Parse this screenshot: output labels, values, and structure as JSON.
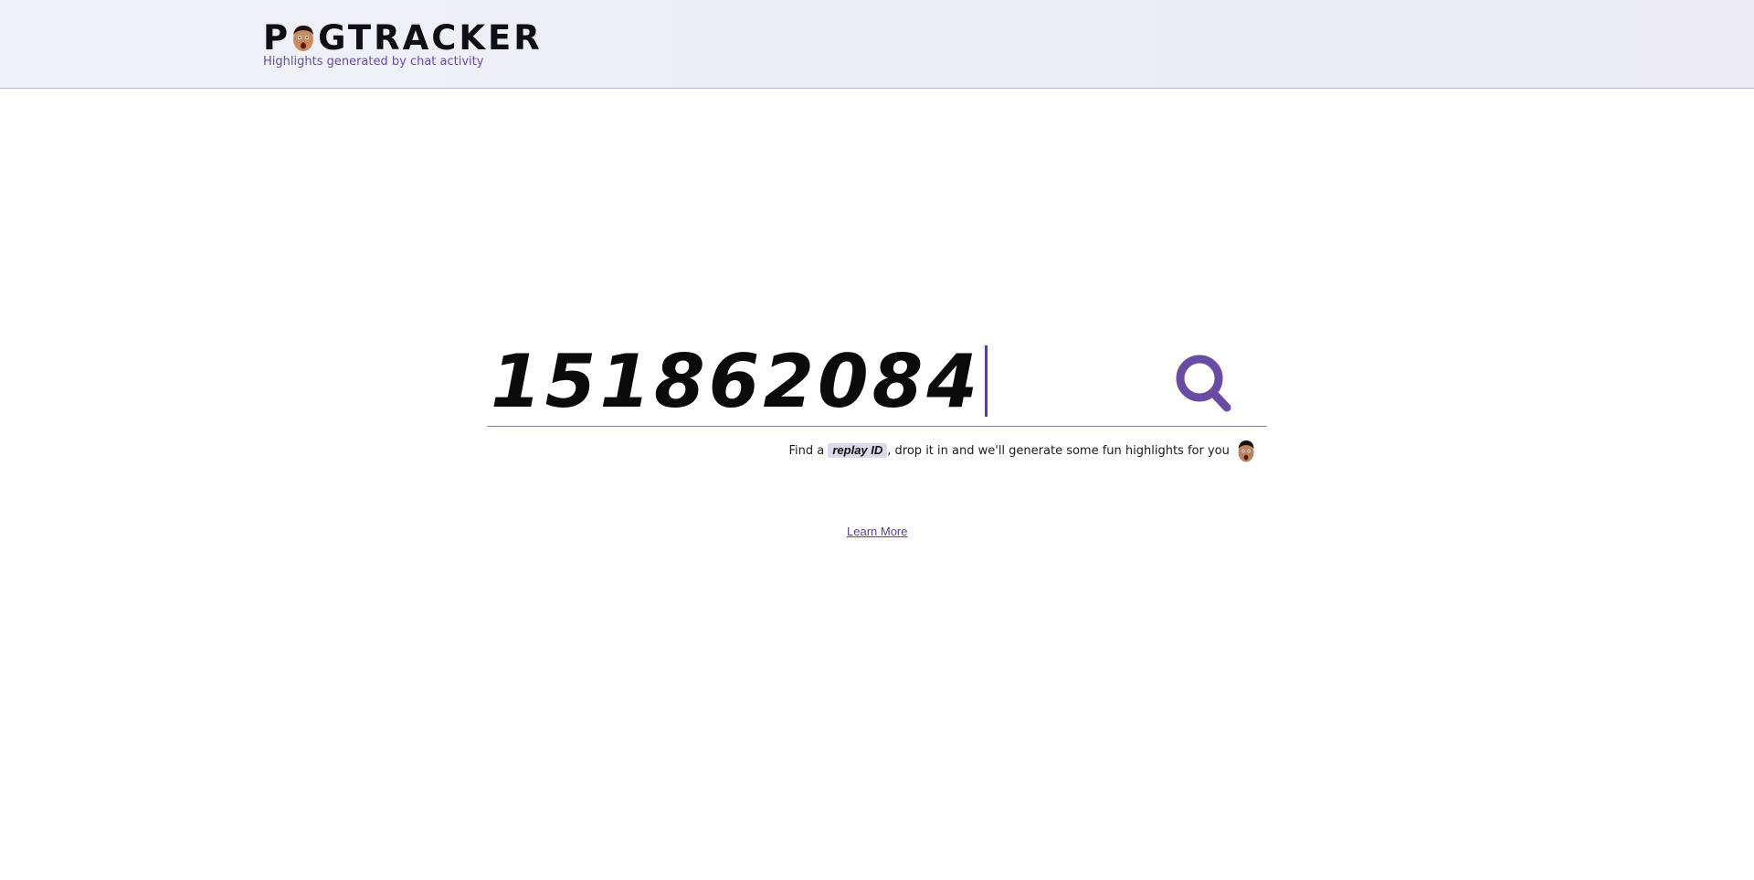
{
  "header": {
    "logo_prefix": "P",
    "logo_suffix": "GTRACKER",
    "logo_icon": "pog-face-icon",
    "tagline": "Highlights generated by chat activity"
  },
  "search": {
    "value": "151862084",
    "placeholder": "",
    "button_icon": "search-icon"
  },
  "hint": {
    "before": "Find a ",
    "highlight": "replay ID",
    "after": ", drop it in and we'll generate some fun highlights for you",
    "icon": "pog-face-icon"
  },
  "learn_more": "Learn More",
  "colors": {
    "accent": "#6a4ba3",
    "text": "#0b0b0b",
    "header_bg": "#eef1f6",
    "highlight_bg": "#ddd8ea"
  }
}
